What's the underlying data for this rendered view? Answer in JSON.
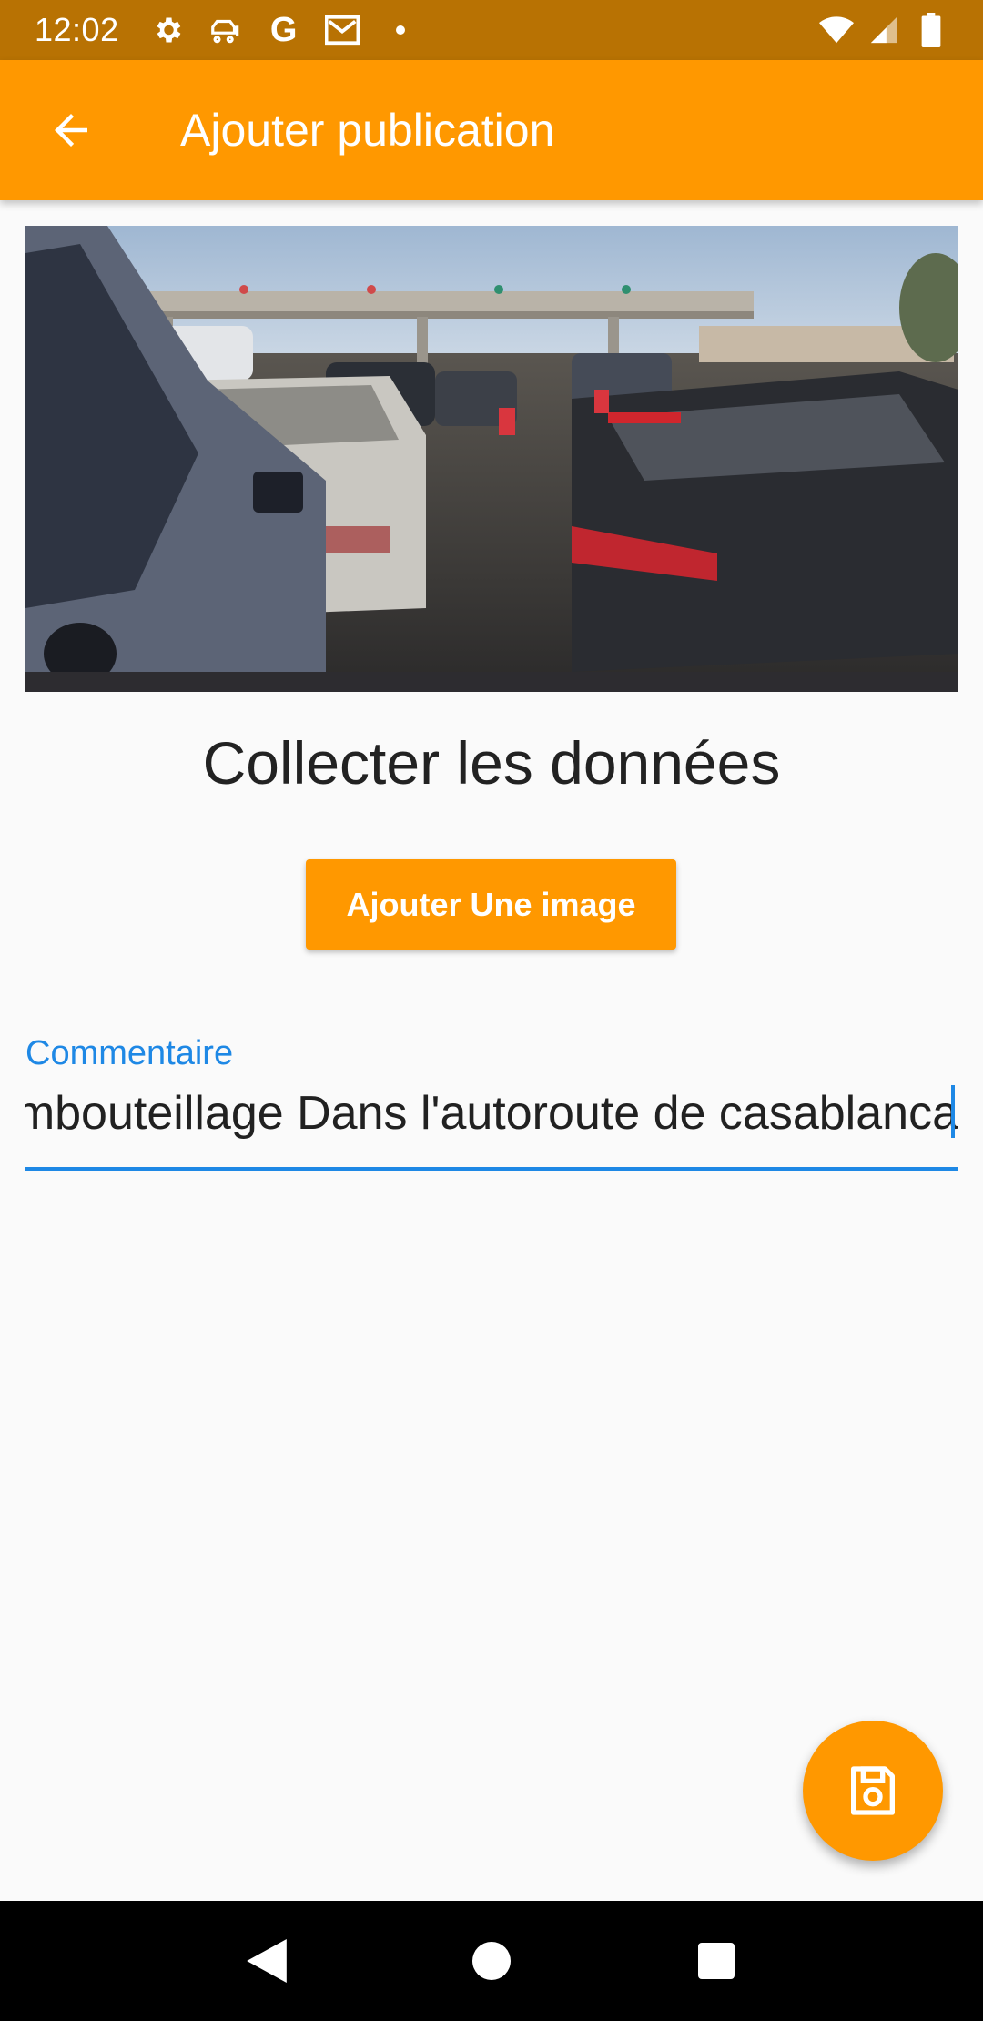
{
  "status_bar": {
    "time": "12:02",
    "icons_left": [
      "settings-icon",
      "car-icon",
      "google-icon",
      "gmail-icon",
      "dot-icon"
    ],
    "google_letter": "G",
    "icons_right": [
      "wifi-icon",
      "signal-icon",
      "battery-icon"
    ]
  },
  "app_bar": {
    "back_icon": "arrow-left-icon",
    "title": "Ajouter publication",
    "color": "#ff9800"
  },
  "hero_image": {
    "subject": "traffic-jam-photo"
  },
  "main": {
    "section_title": "Collecter les données",
    "add_image_button": "Ajouter Une image"
  },
  "comment_field": {
    "label": "Commentaire",
    "value": "Embouteillage Dans l'autoroute de casablanca",
    "accent_color": "#1e88e5"
  },
  "fab": {
    "icon": "save-icon"
  },
  "nav_bar": {
    "buttons": [
      "back-triangle-icon",
      "home-circle-icon",
      "recents-square-icon"
    ]
  }
}
